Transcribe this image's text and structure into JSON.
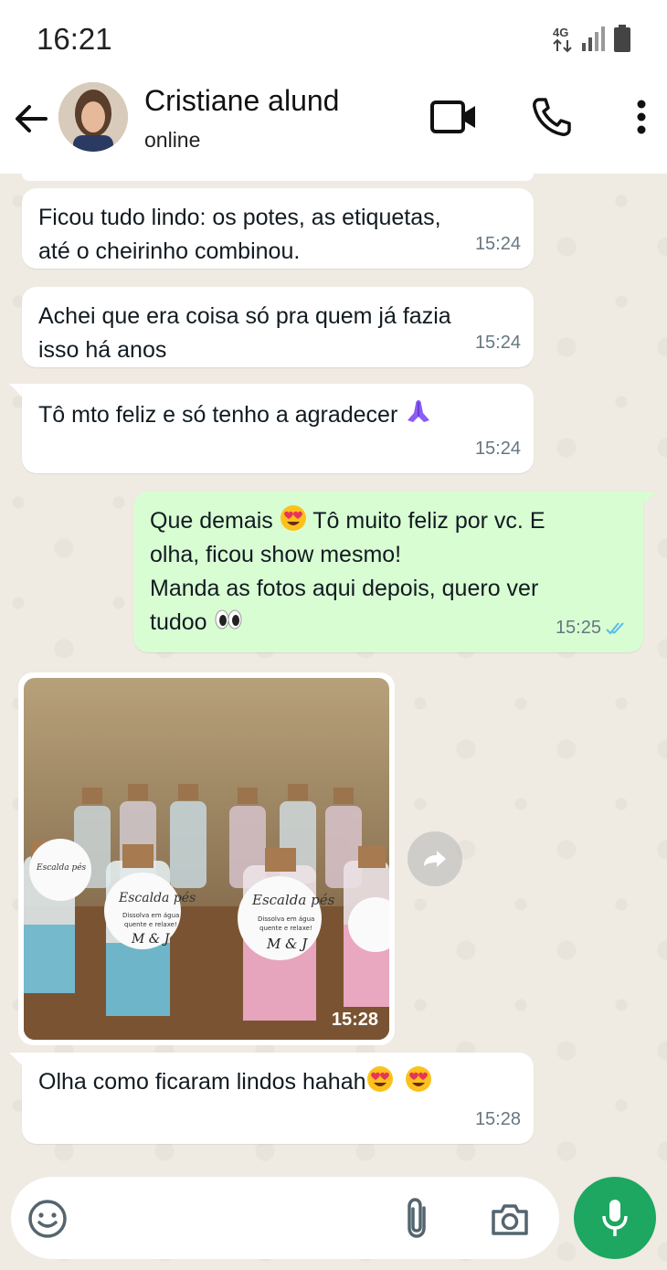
{
  "status_bar": {
    "time": "16:21",
    "network": "4G"
  },
  "header": {
    "contact_name": "Cristiane alund",
    "contact_status": "online"
  },
  "messages": [
    {
      "direction": "in",
      "text_lines": [
        "Ficou tudo lindo: os potes, as etiquetas,",
        "até o cheirinho combinou."
      ],
      "time": "15:24"
    },
    {
      "direction": "in",
      "text_lines": [
        "Achei que era coisa só pra quem já fazia",
        "isso há anos"
      ],
      "time": "15:24"
    },
    {
      "direction": "in",
      "text": "Tô mto feliz e só tenho a agradecer",
      "emoji": "folded-hands",
      "time": "15:24"
    },
    {
      "direction": "out",
      "line1_a": "Que demais",
      "line1_b": "Tô muito feliz por vc. E",
      "line2": "olha, ficou show mesmo!",
      "line3": "Manda as fotos aqui depois, quero ver",
      "line4": "tudoo",
      "time": "15:25",
      "read": true
    },
    {
      "direction": "in",
      "type": "image",
      "time": "15:28",
      "image_caption_tags": [
        "Escalda pés",
        "Dissolva em água quente e relaxe!",
        "M & J"
      ]
    },
    {
      "direction": "in",
      "text": "Olha como ficaram lindos hahah",
      "time": "15:28"
    }
  ],
  "icons": {
    "back": "back-arrow-icon",
    "video": "video-camera-icon",
    "call": "phone-icon",
    "more": "more-vertical-icon",
    "emoji": "smiley-icon",
    "attach": "paperclip-icon",
    "camera": "camera-icon",
    "mic": "microphone-icon",
    "forward": "forward-icon"
  },
  "colors": {
    "outgoing_bubble": "#d9fdd3",
    "incoming_bubble": "#ffffff",
    "mic_button": "#1da760",
    "read_ticks": "#53bdeb"
  }
}
